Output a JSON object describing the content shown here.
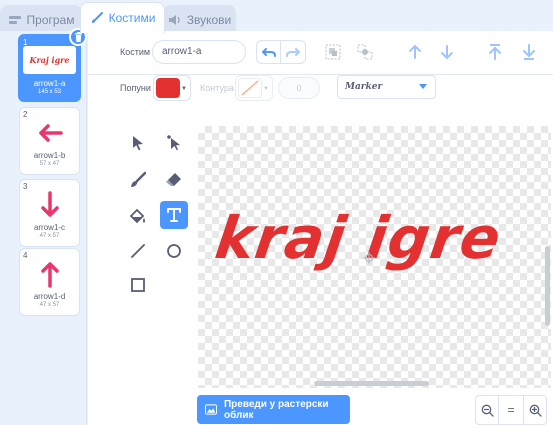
{
  "tabs": [
    {
      "label": "Програм",
      "icon": "code-icon"
    },
    {
      "label": "Костими",
      "icon": "brush-icon",
      "active": true
    },
    {
      "label": "Звукови",
      "icon": "speaker-icon"
    }
  ],
  "costumes": [
    {
      "number": "1",
      "name": "arrow1-a",
      "size": "145 x 53",
      "selected": true,
      "thumb_text": "Kraj igre"
    },
    {
      "number": "2",
      "name": "arrow1-b",
      "size": "57 x 47",
      "arrow": "left"
    },
    {
      "number": "3",
      "name": "arrow1-c",
      "size": "47 x 57",
      "arrow": "down"
    },
    {
      "number": "4",
      "name": "arrow1-d",
      "size": "47 x 57",
      "arrow": "up"
    }
  ],
  "toolbar": {
    "costume_label": "Костим",
    "costume_name": "arrow1-a",
    "fill_label": "Попуни",
    "fill_color": "#e33030",
    "outline_label": "Контура",
    "outline_width": "0",
    "font": "Marker"
  },
  "canvas": {
    "text": "kraj igre",
    "text_color": "#e33030"
  },
  "bitmap_button": "Преведи у растерски облик",
  "zoom": {
    "out": "zoom-out",
    "reset": "=",
    "in": "zoom-in"
  },
  "colors": {
    "accent": "#4c97ff",
    "background": "#e9f1fc",
    "border": "#d9e3f2",
    "arrow": "#e8366f"
  }
}
